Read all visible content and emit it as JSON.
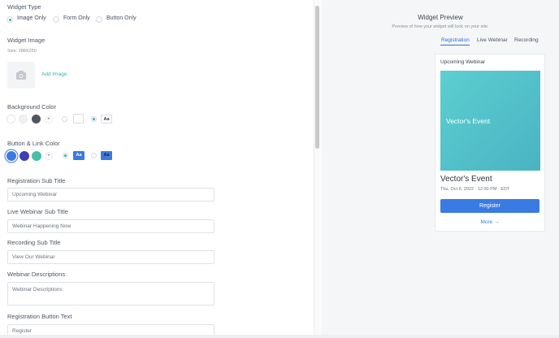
{
  "widget_type": {
    "label": "Widget Type",
    "options": [
      "Image Only",
      "Form Only",
      "Button Only"
    ],
    "selected": "Image Only"
  },
  "widget_image": {
    "label": "Widget Image",
    "size_hint": "Size: 288X250",
    "add_link": "Add Image"
  },
  "background_color": {
    "label": "Background Color",
    "swatches": [
      "#ffffff",
      "#f1f2f4",
      "#4f5661"
    ],
    "aa_text": "Aa"
  },
  "button_link_color": {
    "label": "Button & Link Color",
    "swatches": [
      "#3a7be3",
      "#3f3fb3",
      "#47bfa9"
    ],
    "aa_text": "Aa"
  },
  "fields": {
    "registration_sub_title": {
      "label": "Registration Sub Title",
      "value": "Upcoming Webinar"
    },
    "live_webinar_sub_title": {
      "label": "Live Webinar Sub Title",
      "value": "Webinar Happening Now"
    },
    "recording_sub_title": {
      "label": "Recording Sub Title",
      "value": "View Our Webinar"
    },
    "webinar_descriptions": {
      "label": "Webinar Descriptions",
      "placeholder": "Webinar Descriptions"
    },
    "registration_button_text": {
      "label": "Registration Button Text",
      "value": "Register"
    }
  },
  "preview": {
    "title": "Widget Preview",
    "subtitle": "Preview of how your widget will look on your site.",
    "tabs": [
      "Registration",
      "Live Webinar",
      "Recording"
    ],
    "active_tab": "Registration",
    "card": {
      "heading": "Upcoming Webinar",
      "image_text": "Vector's Event",
      "event_title": "Vector's Event",
      "date": "Thu, Oct 6, 2022 · 12:00 PM - EDT",
      "button_label": "Register",
      "more_link": "More →"
    }
  },
  "colors": {
    "accent_teal": "#3ab5b0",
    "primary_blue": "#3a7be3",
    "preview_bg": "#f5f6f8"
  },
  "icons": {
    "image_placeholder": "camera-icon"
  }
}
